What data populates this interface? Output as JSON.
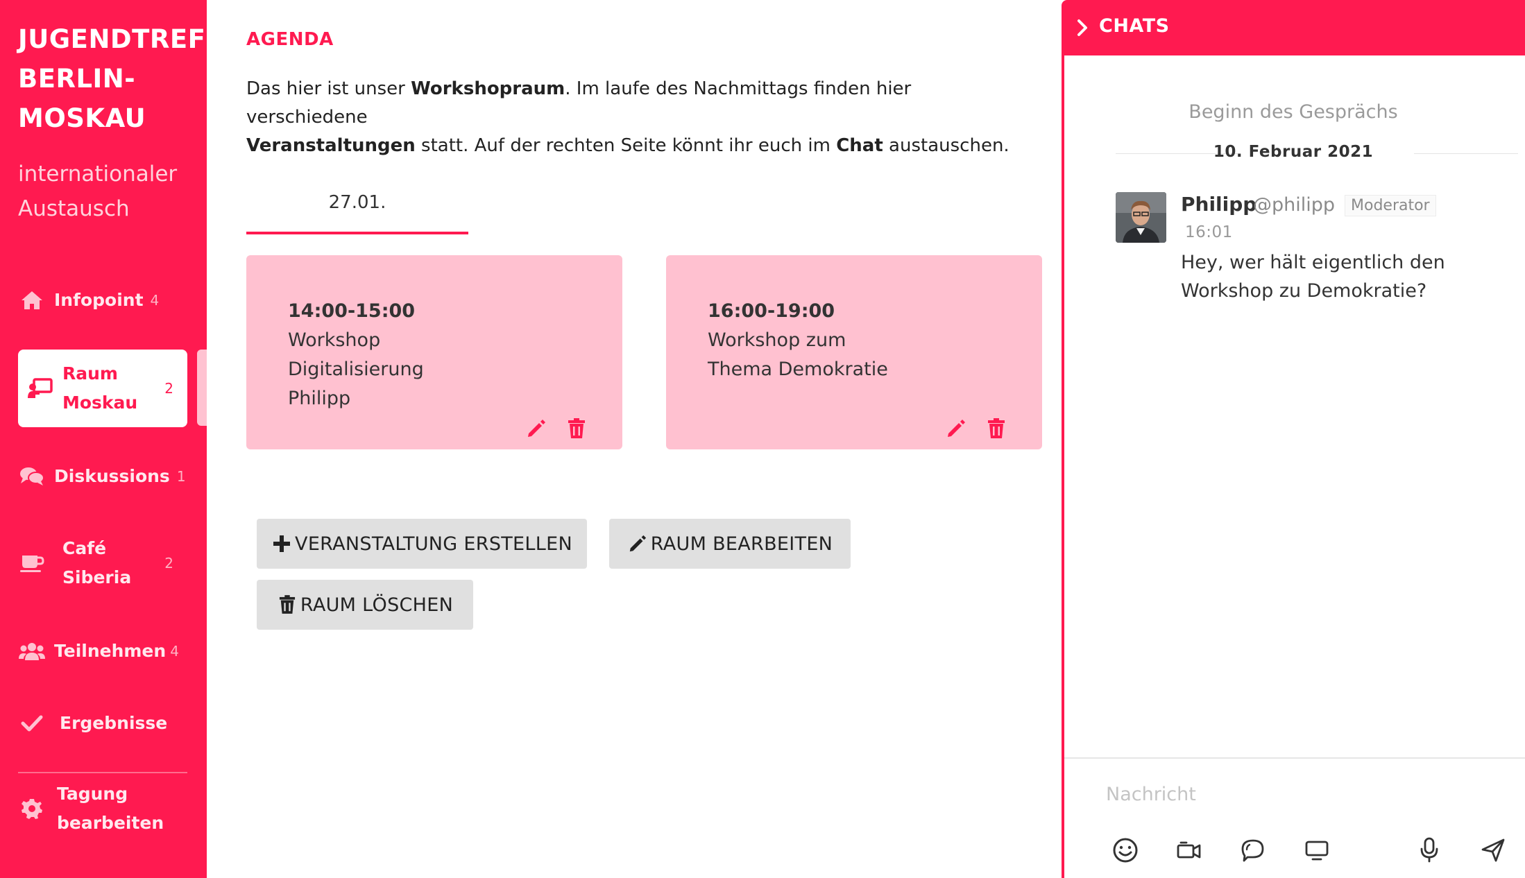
{
  "sidebar": {
    "brand": "JUGENDTREFF\nBERLIN-\nMOSKAU",
    "subtitle": "internationaler\nAustausch",
    "items": [
      {
        "label": "Infopoint",
        "count": "4",
        "icon": "home-icon"
      },
      {
        "label": "Raum\nMoskau",
        "count": "2",
        "icon": "presentation-icon"
      },
      {
        "label": "Diskussions",
        "count": "1",
        "icon": "comments-icon"
      },
      {
        "label": "Café\nSiberia",
        "count": "2",
        "icon": "coffee-cup-icon"
      },
      {
        "label": "Teilnehmen",
        "count": "4",
        "icon": "users-icon"
      },
      {
        "label": "Ergebnisse",
        "count": "",
        "icon": "checkmark-icon"
      },
      {
        "label": "Tagung\nbearbeiten",
        "count": "",
        "icon": "gear-icon"
      }
    ]
  },
  "main": {
    "heading": "AGENDA",
    "intro": {
      "p1": "Das hier ist unser ",
      "b1": "Workshopraum",
      "p2": ". Im laufe des Nachmittags finden hier verschiedene ",
      "b2": "Veranstaltungen",
      "p3": " statt. Auf der rechten Seite könnt ihr euch im ",
      "b3": "Chat",
      "p4": " austauschen."
    },
    "date_tab": "27.01.",
    "events": [
      {
        "time": "14:00-15:00",
        "desc": "Workshop\nDigitalisierung\nPhilipp"
      },
      {
        "time": "16:00-19:00",
        "desc": "Workshop zum\nThema Demokratie"
      }
    ],
    "buttons": {
      "create": "VERANSTALTUNG ERSTELLEN",
      "edit": "RAUM BEARBEITEN",
      "delete": "RAUM LÖSCHEN"
    }
  },
  "chat": {
    "title": "CHATS",
    "begin": "Beginn des Gesprächs",
    "date": "10. Februar 2021",
    "message": {
      "name": "Philipp",
      "handle": "@philipp",
      "role": "Moderator",
      "time": "16:01",
      "text": "Hey, wer hält eigentlich den Workshop zu Demokratie?"
    },
    "input_placeholder": "Nachricht"
  },
  "colors": {
    "accent": "#ff1a50",
    "card": "#ffc1d0",
    "button": "#e0e0e0"
  }
}
